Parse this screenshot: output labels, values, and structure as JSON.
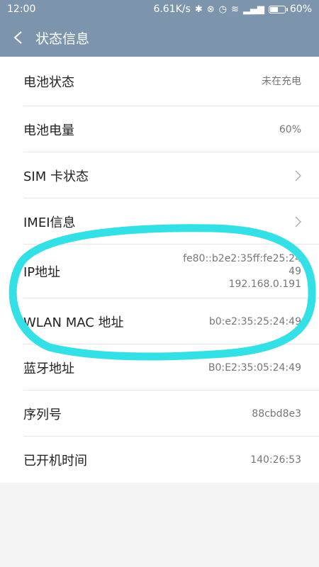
{
  "status_bar": {
    "time": "12:00",
    "speed": "6.61K/s",
    "battery_text": "60%",
    "battery_level": 0.6,
    "icons": [
      "bluetooth-icon",
      "vibrate-icon",
      "alarm-icon",
      "wifi-icon",
      "signal-icon",
      "battery-icon"
    ]
  },
  "header": {
    "title": "状态信息",
    "back_icon": "chevron-left-icon"
  },
  "rows": [
    {
      "label": "电池状态",
      "value": "未在充电"
    },
    {
      "label": "电池电量",
      "value": "60%"
    },
    {
      "label": "SIM 卡状态",
      "value": "",
      "chevron": true
    },
    {
      "label": "IMEI信息",
      "value": "",
      "chevron": true
    },
    {
      "label": "IP地址",
      "value_lines": [
        "fe80::b2e2:35ff:fe25:24",
        "49",
        "192.168.0.191"
      ]
    },
    {
      "label": "WLAN MAC 地址",
      "value": "b0:e2:35:25:24:49"
    },
    {
      "label": "蓝牙地址",
      "value": "B0:E2:35:05:24:49"
    },
    {
      "label": "序列号",
      "value": "88cbd8e3"
    },
    {
      "label": "已开机时间",
      "value": "140:26:53"
    }
  ],
  "colors": {
    "header_bg": "#7d95ac",
    "annotation": "#33e0e6"
  }
}
